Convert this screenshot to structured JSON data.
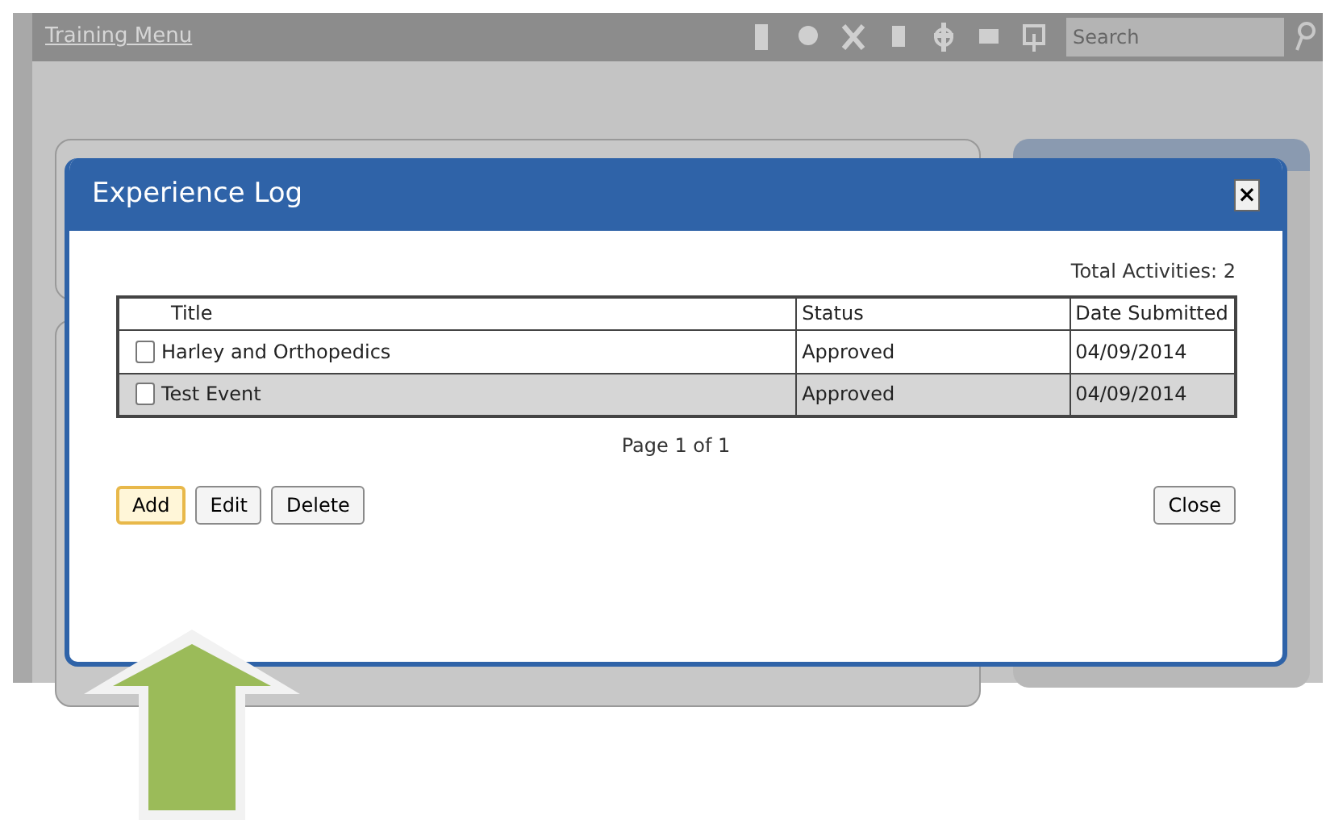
{
  "top_bar": {
    "title": "Training Menu",
    "search": {
      "placeholder": "Search"
    }
  },
  "dialog": {
    "title": "Experience Log",
    "close": "×",
    "total": "Total Activities: 2",
    "table": {
      "columns": [
        "Title",
        "Status",
        "Date Submitted"
      ],
      "rows": [
        {
          "title": "Harley and Orthopedics",
          "status": "Approved",
          "date": "04/09/2014",
          "checked": false
        },
        {
          "title": "Test Event",
          "status": "Approved",
          "date": "04/09/2014",
          "checked": false
        }
      ]
    },
    "pager": "Page 1 of 1",
    "buttons": [
      {
        "label": "Add",
        "highlighted": true
      },
      {
        "label": "Edit",
        "highlighted": false
      },
      {
        "label": "Delete",
        "highlighted": false
      }
    ],
    "close_button": "Close"
  }
}
